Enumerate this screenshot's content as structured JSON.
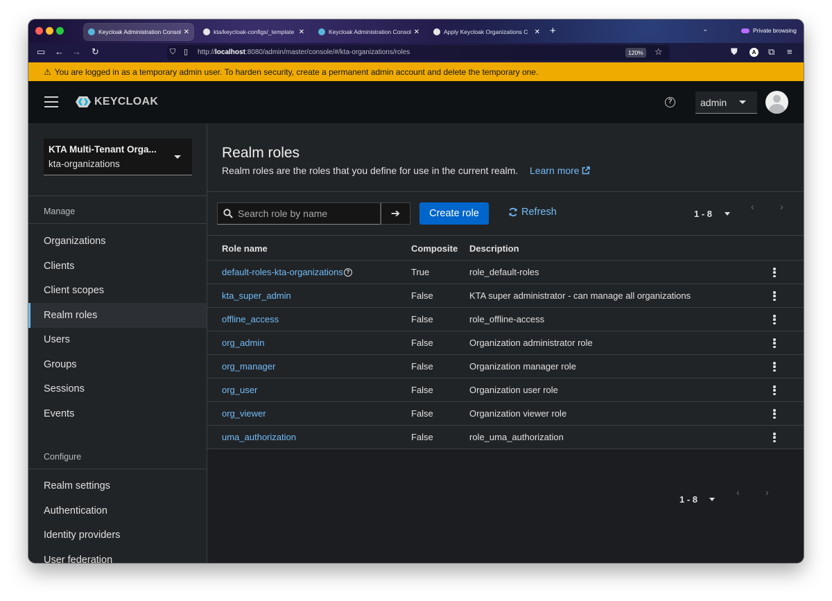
{
  "browser": {
    "tabs": [
      {
        "title": "Keycloak Administration Console",
        "icon": "keycloak-favicon",
        "active": true
      },
      {
        "title": "kta/keycloak-configs/_template",
        "icon": "github-favicon",
        "active": false
      },
      {
        "title": "Keycloak Administration Console",
        "icon": "keycloak-favicon",
        "active": false
      },
      {
        "title": "Apply Keycloak Organizations C",
        "icon": "github-favicon",
        "active": false
      }
    ],
    "private_label": "Private browsing",
    "url_prefix": "http://",
    "url_host": "localhost",
    "url_rest": ":8080/admin/master/console/#/kta-organizations/roles",
    "zoom": "120%"
  },
  "banner": {
    "text": "You are logged in as a temporary admin user. To harden security, create a permanent admin account and delete the temporary one.",
    "color": "#f0ab00"
  },
  "header": {
    "logo_text": "KEYCLOAK",
    "user": "admin"
  },
  "sidebar": {
    "realm_name": "KTA Multi-Tenant Orga...",
    "realm_id": "kta-organizations",
    "manage_heading": "Manage",
    "manage_items": [
      "Organizations",
      "Clients",
      "Client scopes",
      "Realm roles",
      "Users",
      "Groups",
      "Sessions",
      "Events"
    ],
    "active_item": "Realm roles",
    "configure_heading": "Configure",
    "configure_items": [
      "Realm settings",
      "Authentication",
      "Identity providers",
      "User federation"
    ]
  },
  "page": {
    "title": "Realm roles",
    "description": "Realm roles are the roles that you define for use in the current realm.",
    "learn_more": "Learn more"
  },
  "toolbar": {
    "search_placeholder": "Search role by name",
    "create_label": "Create role",
    "refresh_label": "Refresh",
    "pagination": "1 - 8"
  },
  "table": {
    "columns": [
      "Role name",
      "Composite",
      "Description"
    ],
    "rows": [
      {
        "name": "default-roles-kta-organizations",
        "composite": "True",
        "description": "role_default-roles",
        "help": true
      },
      {
        "name": "kta_super_admin",
        "composite": "False",
        "description": "KTA super administrator - can manage all organizations"
      },
      {
        "name": "offline_access",
        "composite": "False",
        "description": "role_offline-access"
      },
      {
        "name": "org_admin",
        "composite": "False",
        "description": "Organization administrator role"
      },
      {
        "name": "org_manager",
        "composite": "False",
        "description": "Organization manager role"
      },
      {
        "name": "org_user",
        "composite": "False",
        "description": "Organization user role"
      },
      {
        "name": "org_viewer",
        "composite": "False",
        "description": "Organization viewer role"
      },
      {
        "name": "uma_authorization",
        "composite": "False",
        "description": "role_uma_authorization"
      }
    ]
  },
  "colors": {
    "accent": "#0066cc",
    "link": "#73bcf7",
    "sidebar_bg": "#212427",
    "header_bg": "#0f1214"
  }
}
